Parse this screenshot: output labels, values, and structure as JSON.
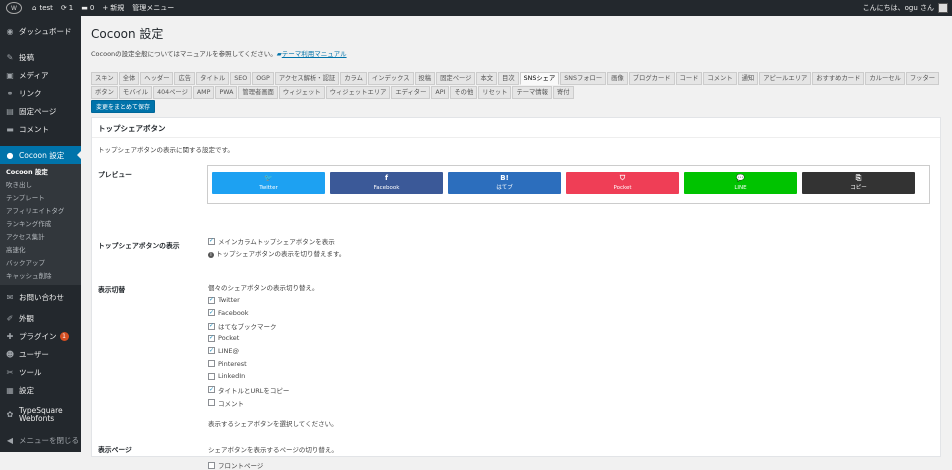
{
  "adminbar": {
    "site": "test",
    "updates": "1",
    "comments": "0",
    "new": "新規",
    "menu": "管理メニュー",
    "greeting": "こんにちは、ogu さん"
  },
  "sidebar": {
    "items": [
      {
        "icon": "◉",
        "label": "ダッシュボード"
      },
      {
        "icon": "✎",
        "label": "投稿"
      },
      {
        "icon": "▣",
        "label": "メディア"
      },
      {
        "icon": "⚭",
        "label": "リンク"
      },
      {
        "icon": "▤",
        "label": "固定ページ"
      },
      {
        "icon": "▬",
        "label": "コメント"
      }
    ],
    "active": {
      "icon": "●",
      "label": "Cocoon 設定"
    },
    "sub": [
      "Cocoon 設定",
      "吹き出し",
      "テンプレート",
      "アフィリエイトタグ",
      "ランキング作成",
      "アクセス集計",
      "高速化",
      "バックアップ",
      "キャッシュ削除"
    ],
    "items2": [
      {
        "icon": "✉",
        "label": "お問い合わせ"
      },
      {
        "icon": "✐",
        "label": "外観"
      },
      {
        "icon": "✚",
        "label": "プラグイン",
        "badge": "1"
      },
      {
        "icon": "☻",
        "label": "ユーザー"
      },
      {
        "icon": "✂",
        "label": "ツール"
      },
      {
        "icon": "▦",
        "label": "設定"
      },
      {
        "icon": "✿",
        "label": "TypeSquare Webfonts"
      },
      {
        "icon": "◀",
        "label": "メニューを閉じる"
      }
    ]
  },
  "page": {
    "title": "Cocoon 設定",
    "desc": "Cocoonの設定全般についてはマニュアルを参照してください。",
    "manual_link": "テーマ利用マニュアル",
    "save_button": "変更をまとめて保存"
  },
  "tabs": [
    "スキン",
    "全体",
    "ヘッダー",
    "広告",
    "タイトル",
    "SEO",
    "OGP",
    "アクセス解析・認証",
    "カラム",
    "インデックス",
    "投稿",
    "固定ページ",
    "本文",
    "目次",
    "SNSシェア",
    "SNSフォロー",
    "画像",
    "ブログカード",
    "コード",
    "コメント",
    "通知",
    "アピールエリア",
    "おすすめカード",
    "カルーセル",
    "フッター",
    "ボタン",
    "モバイル",
    "404ページ",
    "AMP",
    "PWA",
    "管理者画面",
    "ウィジェット",
    "ウィジェットエリア",
    "エディター",
    "API",
    "その他",
    "リセット",
    "テーマ情報",
    "寄付"
  ],
  "selected_tab": "SNSシェア",
  "section": {
    "title": "トップシェアボタン",
    "desc": "トップシェアボタンの表示に関する設定です。"
  },
  "preview": {
    "label": "プレビュー",
    "buttons": [
      {
        "glyph": "🐦",
        "text": "Twitter",
        "color": "#1da1f2"
      },
      {
        "glyph": "f",
        "text": "Facebook",
        "color": "#3b5998"
      },
      {
        "glyph": "B!",
        "text": "はてブ",
        "color": "#2c6ebd"
      },
      {
        "glyph": "⛉",
        "text": "Pocket",
        "color": "#ef3e56"
      },
      {
        "glyph": "💬",
        "text": "LINE",
        "color": "#00c300"
      },
      {
        "glyph": "⎘",
        "text": "コピー",
        "color": "#333333"
      }
    ]
  },
  "display": {
    "label": "トップシェアボタンの表示",
    "check": "メインカラムトップシェアボタンを表示",
    "note": "トップシェアボタンの表示を切り替えます。"
  },
  "toggle": {
    "label": "表示切替",
    "intro": "個々のシェアボタンの表示切り替え。",
    "items": [
      {
        "text": "Twitter",
        "checked": true
      },
      {
        "text": "Facebook",
        "checked": true
      },
      {
        "text": "はてなブックマーク",
        "checked": true
      },
      {
        "text": "Pocket",
        "checked": true
      },
      {
        "text": "LINE@",
        "checked": true
      },
      {
        "text": "Pinterest",
        "checked": false
      },
      {
        "text": "LinkedIn",
        "checked": false
      },
      {
        "text": "タイトルとURLをコピー",
        "checked": true
      },
      {
        "text": "コメント",
        "checked": false
      }
    ],
    "note": "表示するシェアボタンを選択してください。"
  },
  "pages": {
    "label": "表示ページ",
    "intro": "シェアボタンを表示するページの切り替え。",
    "first": "フロントページ"
  }
}
